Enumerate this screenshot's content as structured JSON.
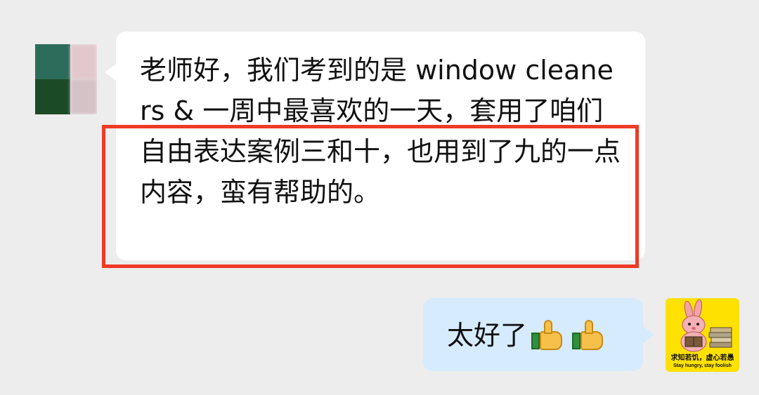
{
  "chat": {
    "incoming_message": "老师好，我们考到的是 window cleaners & 一周中最喜欢的一天，套用了咱们自由表达案例三和十，也用到了九的一点内容，蛮有帮助的。",
    "outgoing_message": "太好了"
  },
  "right_avatar": {
    "caption_cn": "求知若饥，虚心若愚",
    "caption_en": "Stay hungry, stay foolish",
    "background": "#ffe100"
  },
  "colors": {
    "page_background": "#ededed",
    "incoming_bubble": "#ffffff",
    "outgoing_bubble": "#d6ebfd",
    "highlight_border": "#ef3a25"
  },
  "icons": {
    "reaction": "thumbs-up-icon"
  }
}
